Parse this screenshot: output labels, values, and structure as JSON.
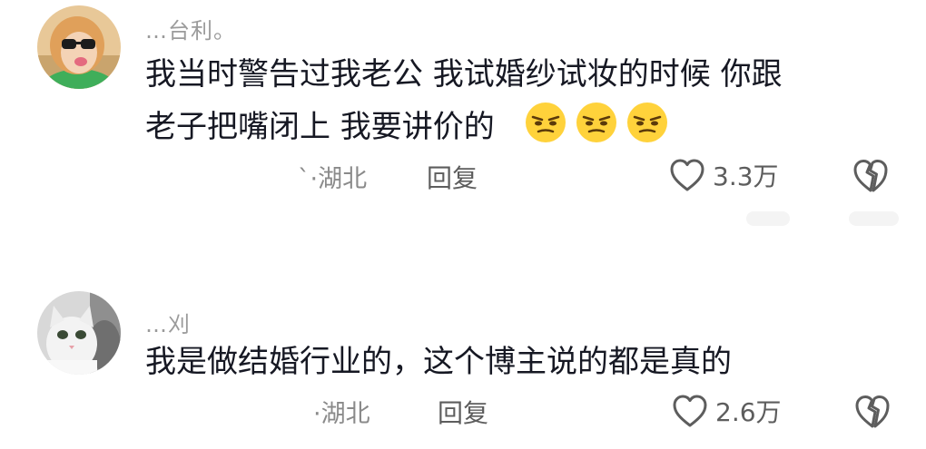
{
  "comments": [
    {
      "username": "…台利。",
      "text_lines": [
        "我当时警告过我老公 我试婚纱试妆的时候 你跟",
        "老子把嘴闭上  我要讲价的"
      ],
      "emojis": [
        "smirk-emoji",
        "smirk-emoji",
        "smirk-emoji"
      ],
      "location": "`·湖北",
      "reply_label": "回复",
      "likes": "3.3万"
    },
    {
      "username": "…刈",
      "text_lines": [
        "我是做结婚行业的，这个博主说的都是真的"
      ],
      "location": "·湖北",
      "reply_label": "回复",
      "likes": "2.6万"
    }
  ],
  "colors": {
    "text": "#161823",
    "secondary": "#8a8a8a",
    "icon": "#5d5d5d",
    "emoji_face": "#ffd23b"
  }
}
